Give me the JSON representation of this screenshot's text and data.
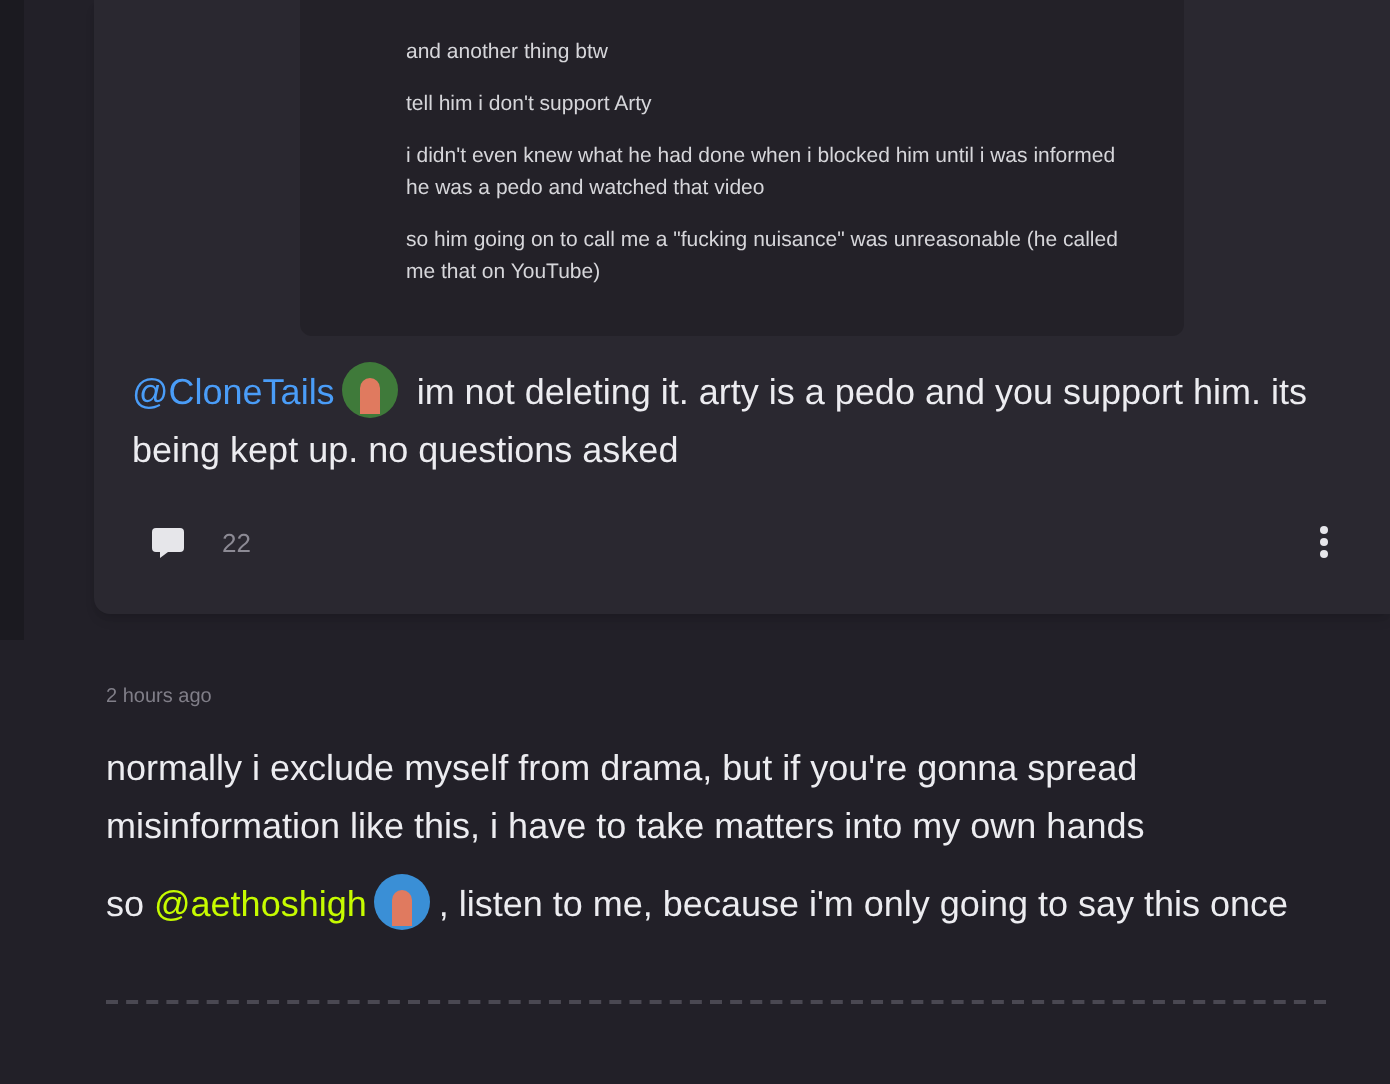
{
  "quoted_post": {
    "lines": [
      "and another thing btw",
      "tell him i don't support Arty",
      "i didn't even knew what he had done when i blocked him until i was informed he was a pedo and watched that video",
      "so him going on to call me a \"fucking nuisance\" was unreasonable (he called me that on YouTube)"
    ]
  },
  "reply": {
    "message": [
      {
        "kind": "mention",
        "text": "@CloneTails",
        "color": "#4a9df8"
      },
      {
        "kind": "avatar",
        "color": "#3f7a3a"
      },
      {
        "kind": "text",
        "text": " im not deleting it. arty is a pedo and you support him. its being kept up. no questions asked"
      }
    ],
    "comment_count": "22"
  },
  "post": {
    "time": "2 hours ago",
    "paragraphs": [
      [
        {
          "kind": "text",
          "text": "normally i exclude myself from drama, but if you're gonna spread misinformation like this, i have to take matters into my own hands"
        }
      ],
      [
        {
          "kind": "text",
          "text": "so "
        },
        {
          "kind": "mention",
          "text": "@aethoshigh",
          "color": "#c6fb00"
        },
        {
          "kind": "avatar",
          "color": "#3a8fd6"
        },
        {
          "kind": "text",
          "text": ", listen to me, because i'm only going to say this once"
        }
      ]
    ]
  }
}
